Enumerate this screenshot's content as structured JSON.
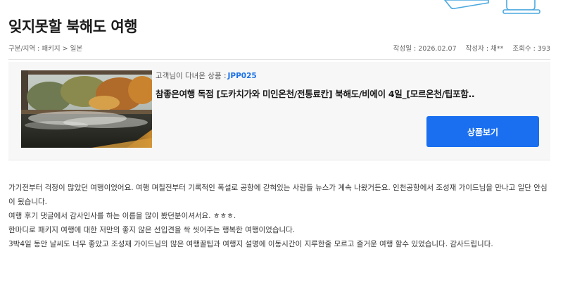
{
  "title": "잊지못할 북해도 여행",
  "meta": {
    "category": "구분/지역 : 패키지 > 일본",
    "date": "작성일 : 2026.02.07",
    "author": "작성자 : 채**",
    "views": "조회수 : 393"
  },
  "product": {
    "visited_label": "고객님이 다녀온 상품 :",
    "code": "JPP025",
    "name": "참좋은여행 독점 [도카치가와 미인온천/전통료칸] 북해도/비에이 4일_[모르온천/팁포함..",
    "button_label": "상품보기",
    "button_color": "#1a6ff0",
    "code_color": "#1e73e8",
    "thumbnail": "outdoor-hot-spring-photo"
  },
  "review": {
    "paragraphs": [
      "가기전부터 걱정이 많았던 여행이었어요. 여행 며칠전부터 기록적인 폭설로 공항에 갇혀있는 사람들 뉴스가 계속 나왔거든요. 인천공항에서 조성재 가이드님을 만나고 일단 안심이 됬습니다.",
      "여행 후기 댓글에서 감사인사를 하는 이름을 많이 봤던분이셔서요. ㅎㅎㅎ.",
      "한마디로 패키지 여행에 대한 저만의 좋지 않은 선입견을 싹 씻어주는 행복한 여행이었습니다.",
      "3박4일 동안 날씨도 너무 좋았고 조성재 가이드님의 많은 여행꿀팁과 여행지 설명에 이동시간이 지루한줄 모르고 즐거운 여행 할수 있었습니다. 감사드립니다."
    ]
  }
}
